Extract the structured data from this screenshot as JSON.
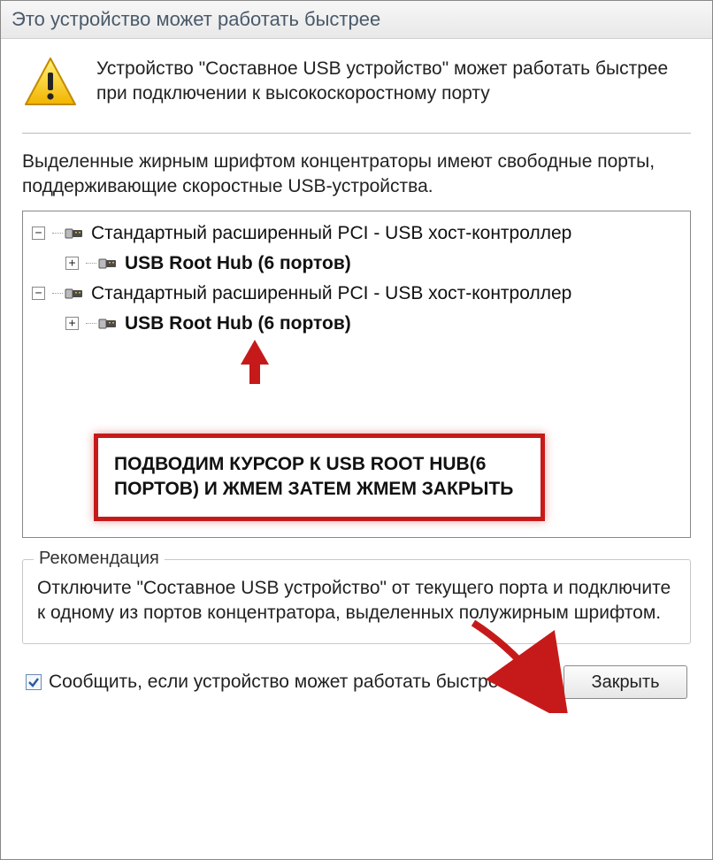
{
  "titlebar": "Это устройство может работать быстрее",
  "header_message": "Устройство \"Составное USB устройство\" может работать быстрее при подключении к высокоскоростному порту",
  "instruction": "Выделенные жирным шрифтом концентраторы имеют свободные порты, поддерживающие скоростные USB-устройства.",
  "tree": {
    "rows": [
      {
        "indent": 0,
        "expand": "−",
        "label": "Стандартный расширенный PCI - USB хост-контроллер",
        "bold": false
      },
      {
        "indent": 1,
        "expand": "+",
        "label": "USB Root Hub (6 портов)",
        "bold": true
      },
      {
        "indent": 0,
        "expand": "−",
        "label": "Стандартный расширенный PCI - USB хост-контроллер",
        "bold": false
      },
      {
        "indent": 1,
        "expand": "+",
        "label": "USB Root Hub (6 портов)",
        "bold": true
      }
    ]
  },
  "callout": "ПОДВОДИМ КУРСОР К USB ROOT HUB(6 ПОРТОВ) И ЖМЕМ ЗАТЕМ ЖМЕМ ЗАКРЫТЬ",
  "recommendation": {
    "label": "Рекомендация",
    "text": "Отключите \"Составное USB устройство\" от текущего порта и подключите к одному из портов концентратора, выделенных полужирным шрифтом."
  },
  "checkbox_label": "Сообщить, если устройство может работать быстрее",
  "checkbox_checked": true,
  "close_button": "Закрыть"
}
